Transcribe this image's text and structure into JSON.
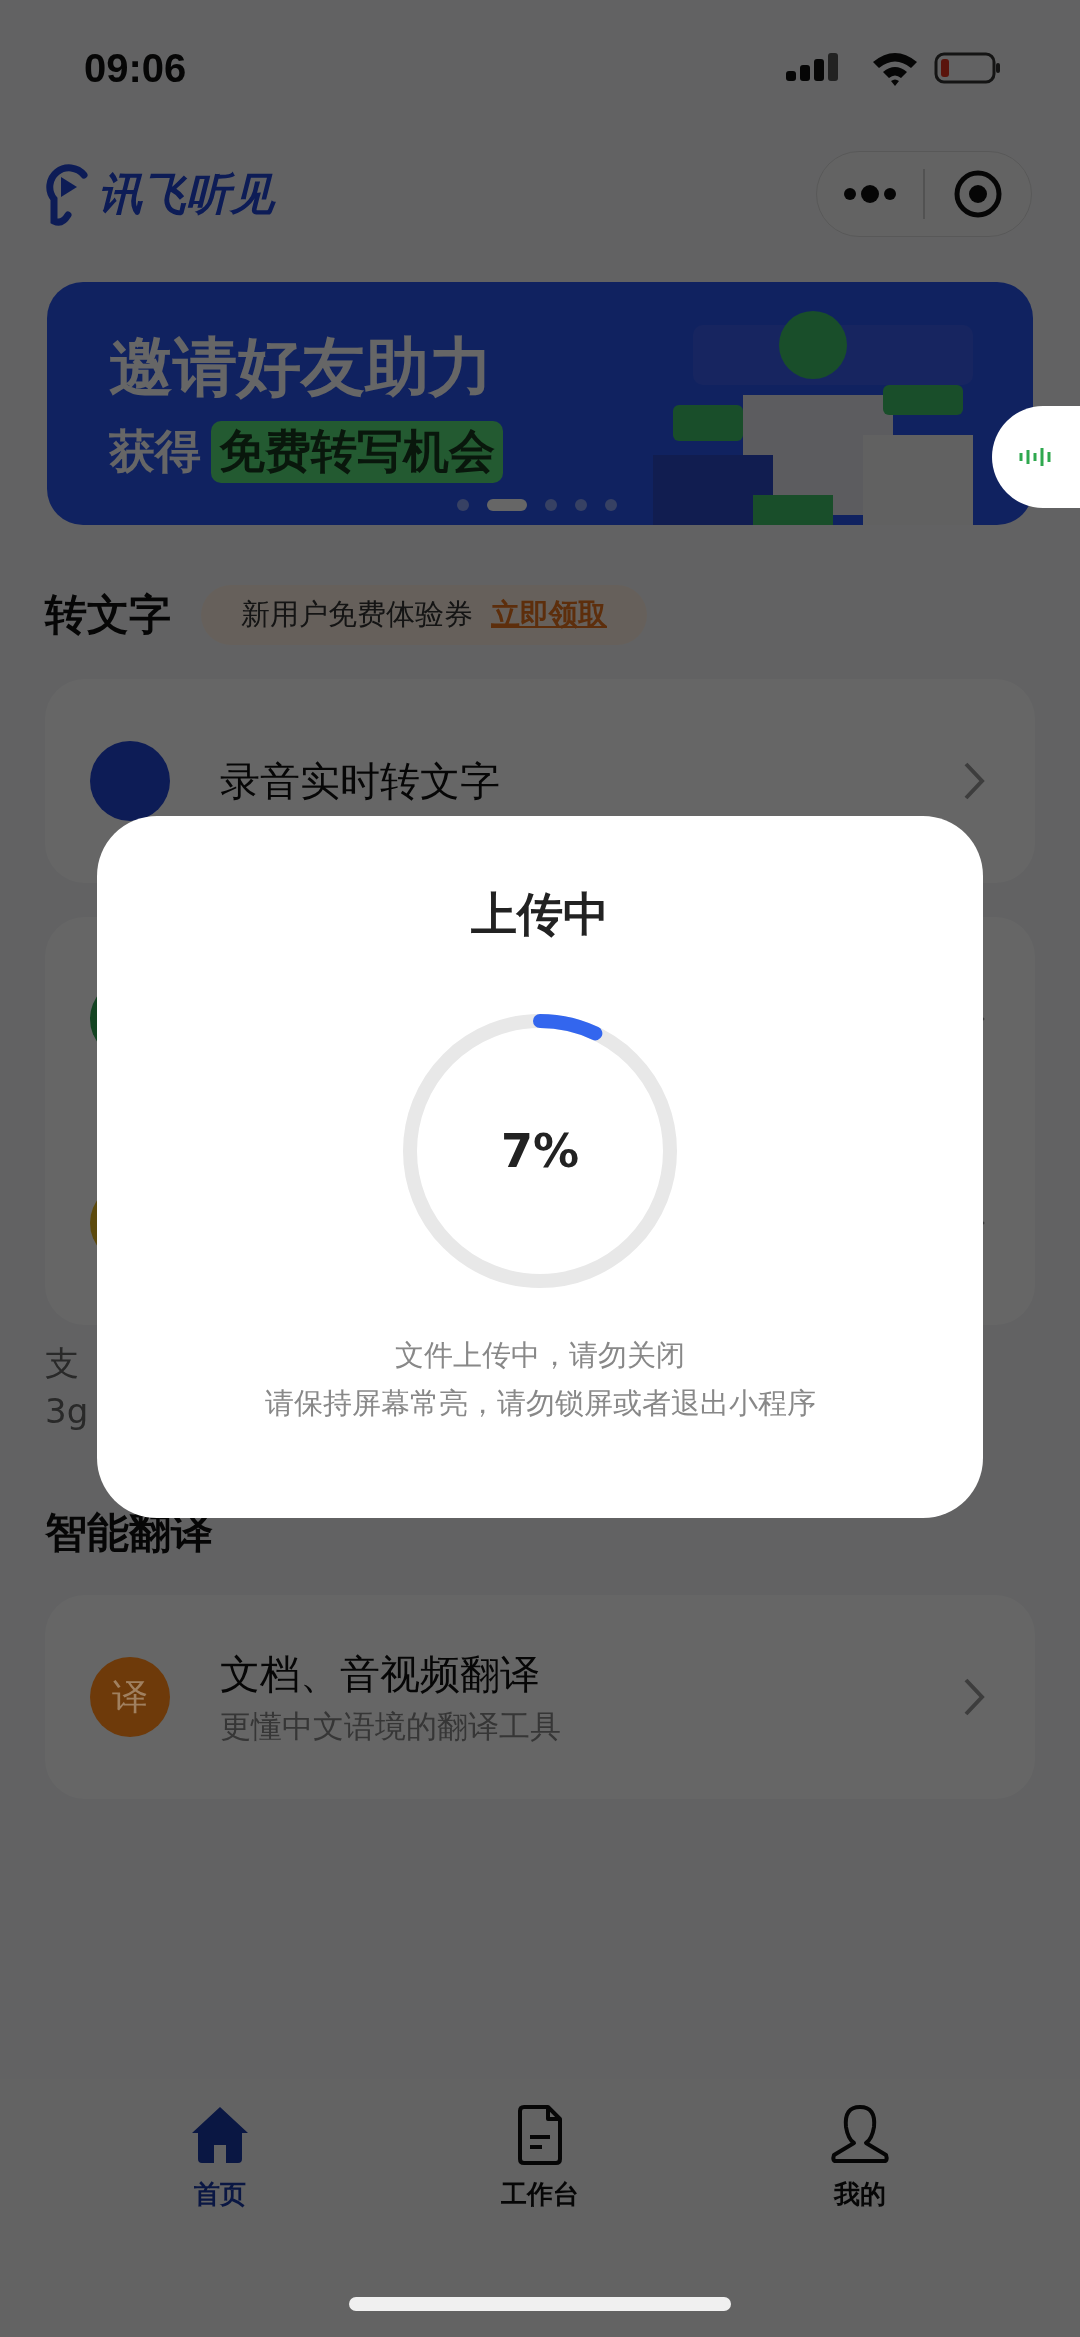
{
  "status_bar": {
    "time": "09:06"
  },
  "header": {
    "logo_text": "讯飞听见"
  },
  "banner": {
    "headline": "邀请好友助力",
    "subline_prefix": "获得",
    "subline_highlight": "免费转写机会",
    "dots": [
      {
        "selected": false
      },
      {
        "selected": true
      },
      {
        "selected": false
      },
      {
        "selected": false
      },
      {
        "selected": false
      }
    ]
  },
  "transcribe": {
    "title": "转文字",
    "coupon": {
      "text": "新用户免费体验券",
      "link": "立即领取"
    },
    "cards": [
      {
        "items": [
          {
            "title": "录音实时转文字",
            "color": "#0d1c56"
          }
        ]
      },
      {
        "items": [
          {
            "color": "#134321"
          },
          {
            "color": "#5d4a0d"
          }
        ]
      }
    ],
    "note_lines": [
      "支",
      "3g"
    ]
  },
  "translate": {
    "title": "智能翻译",
    "items": [
      {
        "icon_text": "译",
        "title": "文档、音视频翻译",
        "subtitle": "更懂中文语境的翻译工具",
        "color": "#6e3a0a"
      }
    ]
  },
  "tab_bar": {
    "tabs": [
      {
        "label": "首页",
        "selected": true
      },
      {
        "label": "工作台",
        "selected": false
      },
      {
        "label": "我的",
        "selected": false
      }
    ]
  },
  "upload_dialog": {
    "title": "上传中",
    "level": 0.07,
    "percent": "7%",
    "messages": [
      "文件上传中，请勿关闭",
      "请保持屏幕常亮，请勿锁屏或者退出小程序"
    ]
  }
}
